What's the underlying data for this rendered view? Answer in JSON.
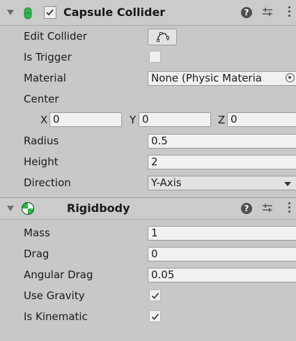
{
  "capsule_collider": {
    "title": "Capsule Collider",
    "enabled": true,
    "edit_collider_label": "Edit Collider",
    "is_trigger_label": "Is Trigger",
    "is_trigger": false,
    "material_label": "Material",
    "material_value": "None (Physic Materia",
    "center_label": "Center",
    "center": {
      "x_label": "X",
      "x": "0",
      "y_label": "Y",
      "y": "0",
      "z_label": "Z",
      "z": "0"
    },
    "radius_label": "Radius",
    "radius": "0.5",
    "height_label": "Height",
    "height": "2",
    "direction_label": "Direction",
    "direction": "Y-Axis"
  },
  "rigidbody": {
    "title": "Rigidbody",
    "mass_label": "Mass",
    "mass": "1",
    "drag_label": "Drag",
    "drag": "0",
    "angular_drag_label": "Angular Drag",
    "angular_drag": "0.05",
    "use_gravity_label": "Use Gravity",
    "use_gravity": true,
    "is_kinematic_label": "Is Kinematic",
    "is_kinematic": true
  },
  "icons": {
    "fold": "triangle-down-icon",
    "capsule": "capsule-collider-icon",
    "rigidbody": "rigidbody-icon",
    "help": "help-icon",
    "presets": "presets-icon",
    "menu": "kebab-menu-icon",
    "edit": "edit-collider-icon",
    "object_picker": "object-picker-icon",
    "dropdown": "dropdown-arrow-icon"
  },
  "colors": {
    "capsule_green": "#2db84a",
    "background": "#c8c8c8",
    "field": "#f1f1f1"
  }
}
